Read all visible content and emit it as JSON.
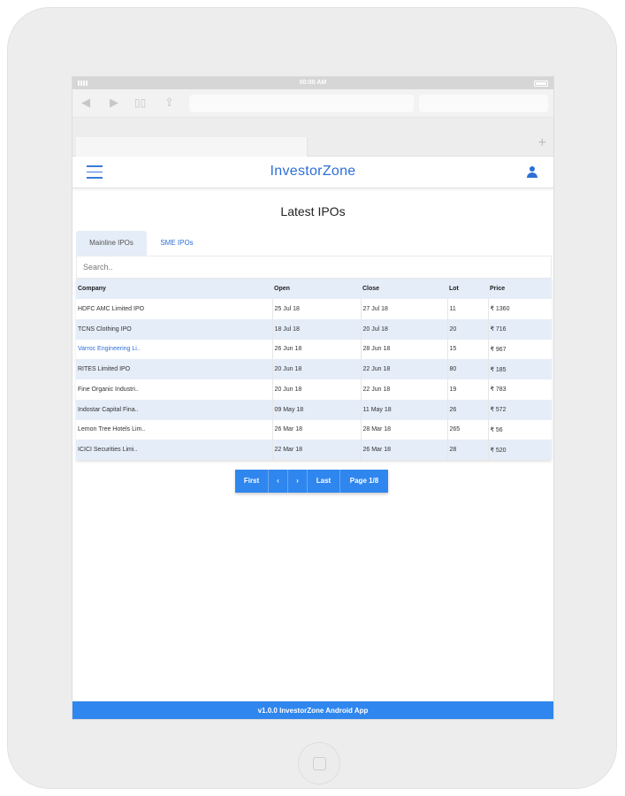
{
  "status_bar": {
    "time": "00:00 AM"
  },
  "browser": {
    "tab_add": "+"
  },
  "header": {
    "title": "InvestorZone"
  },
  "page": {
    "title": "Latest IPOs"
  },
  "tabs": [
    {
      "label": "Mainline IPOs"
    },
    {
      "label": "SME IPOs"
    }
  ],
  "search": {
    "placeholder": "Search.."
  },
  "table": {
    "columns": [
      "Company",
      "Open",
      "Close",
      "Lot",
      "Price"
    ],
    "rows": [
      [
        "HDFC AMC Limited IPO",
        "25 Jul 18",
        "27 Jul 18",
        "11",
        "₹ 1360"
      ],
      [
        "TCNS Clothing IPO",
        "18 Jul 18",
        "20 Jul 18",
        "20",
        "₹ 716"
      ],
      [
        "Varroc Engineering Li..",
        "26 Jun 18",
        "28 Jun 18",
        "15",
        "₹ 967"
      ],
      [
        "RITES Limited IPO",
        "20 Jun 18",
        "22 Jun 18",
        "80",
        "₹ 185"
      ],
      [
        "Fine Organic Industri..",
        "20 Jun 18",
        "22 Jun 18",
        "19",
        "₹ 783"
      ],
      [
        "Indostar Capital Fina..",
        "09 May 18",
        "11 May 18",
        "26",
        "₹ 572"
      ],
      [
        "Lemon Tree Hotels Lim..",
        "26 Mar 18",
        "28 Mar 18",
        "265",
        "₹ 56"
      ],
      [
        "ICICI Securities Limi..",
        "22 Mar 18",
        "26 Mar 18",
        "28",
        "₹ 520"
      ]
    ]
  },
  "pagination": {
    "first": "First",
    "prev": "‹",
    "next": "›",
    "last": "Last",
    "page": "Page 1/8"
  },
  "footer": {
    "text": "v1.0.0 InvestorZone Android App"
  },
  "colors": {
    "accent": "#2f86ee",
    "brand": "#2d6fd6",
    "row_alt": "#e5edf8"
  }
}
